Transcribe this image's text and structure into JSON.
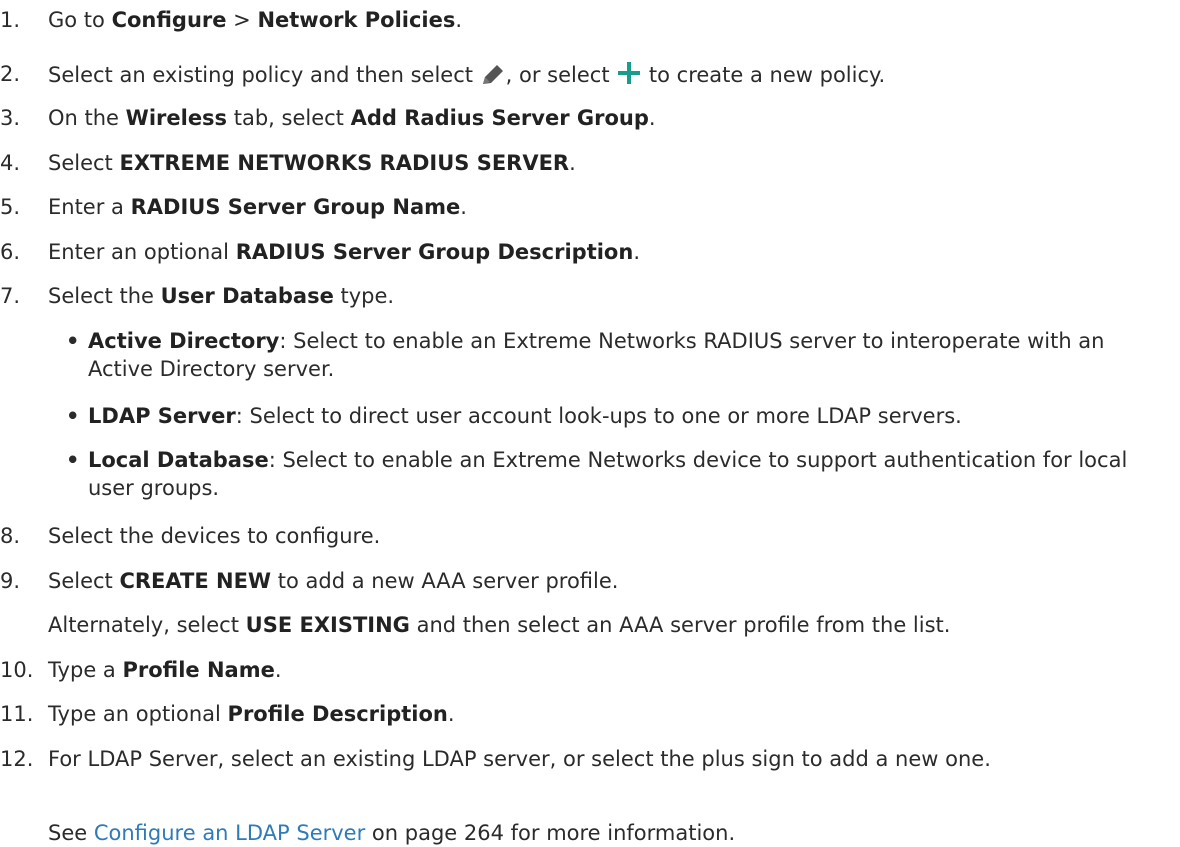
{
  "steps": [
    {
      "num": "1.",
      "t1": "Go to ",
      "b1": "Configure",
      "t2": " > ",
      "b2": "Network Policies",
      "t3": "."
    },
    {
      "num": "2.",
      "t1": "Select an existing policy and then select ",
      "icon1": "pencil-icon",
      "t2": ", or select ",
      "icon2": "plus-icon",
      "t3": " to create a new policy."
    },
    {
      "num": "3.",
      "t1": "On the ",
      "b1": "Wireless",
      "t2": " tab, select ",
      "b2": "Add Radius Server Group",
      "t3": "."
    },
    {
      "num": "4.",
      "t1": "Select ",
      "b1": "EXTREME NETWORKS RADIUS SERVER",
      "t2": "."
    },
    {
      "num": "5.",
      "t1": "Enter a ",
      "b1": "RADIUS Server Group Name",
      "t2": "."
    },
    {
      "num": "6.",
      "t1": "Enter an optional ",
      "b1": "RADIUS Server Group Description",
      "t2": "."
    },
    {
      "num": "7.",
      "t1": "Select the ",
      "b1": "User Database",
      "t2": " type."
    },
    {
      "num": "8.",
      "t1": "Select the devices to configure."
    },
    {
      "num": "9.",
      "t1": "Select ",
      "b1": "CREATE NEW",
      "t2": " to add a new AAA server profile."
    },
    {
      "num": "10.",
      "t1": "Type a ",
      "b1": "Profile Name",
      "t2": "."
    },
    {
      "num": "11.",
      "t1": "Type an optional ",
      "b1": "Profile Description",
      "t2": "."
    },
    {
      "num": "12.",
      "t1": "For LDAP Server, select an existing LDAP server, or select the plus sign to add a new one."
    }
  ],
  "bullets": [
    {
      "dot": "•",
      "b1": "Active Directory",
      "t1": ": Select to enable an Extreme Networks RADIUS server to interoperate with an Active Directory server."
    },
    {
      "dot": "•",
      "b1": "LDAP Server",
      "t1": ": Select to direct user account look-ups to one or more LDAP servers."
    },
    {
      "dot": "•",
      "b1": "Local Database",
      "t1": ": Select to enable an Extreme Networks device to support authentication for local user groups."
    }
  ],
  "step9_note": {
    "t1": "Alternately, select ",
    "b1": "USE EXISTING",
    "t2": " and then select an AAA server profile from the list."
  },
  "step12_note": {
    "t1": "See ",
    "link": "Configure an LDAP Server",
    "t2": " on page 264 for more information."
  },
  "colors": {
    "text": "#2b2b2b",
    "link": "#2e7bb8",
    "plus_icon": "#1a9c8c",
    "pencil_icon": "#555555"
  }
}
